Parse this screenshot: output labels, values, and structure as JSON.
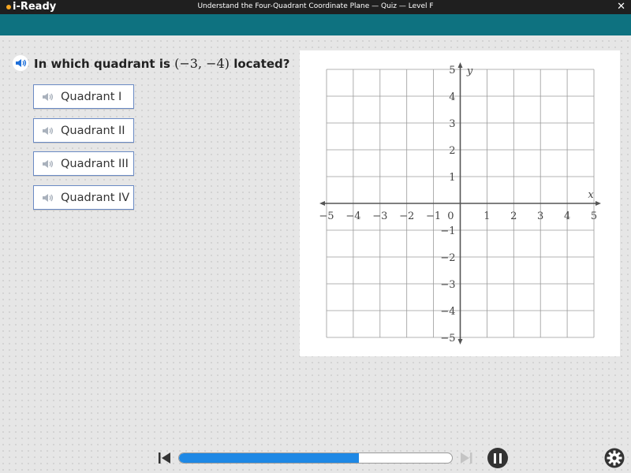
{
  "app": {
    "logo": "i-Ready",
    "title": "Understand the Four-Quadrant Coordinate Plane — Quiz — Level F",
    "close_label": "✕"
  },
  "colors": {
    "teal_bar": "#0e7280",
    "accent_blue": "#1e88e5",
    "answer_border": "#6a8ac4"
  },
  "question": {
    "prefix": "In which quadrant is",
    "math": "(−3, −4)",
    "suffix": "located?"
  },
  "answers": [
    {
      "label": "Quadrant I"
    },
    {
      "label": "Quadrant II"
    },
    {
      "label": "Quadrant III"
    },
    {
      "label": "Quadrant IV"
    }
  ],
  "graph": {
    "x_label": "x",
    "y_label": "y",
    "x_ticks": [
      "−5",
      "−4",
      "−3",
      "−2",
      "−1",
      "1",
      "2",
      "3",
      "4",
      "5"
    ],
    "y_ticks": [
      "5",
      "4",
      "3",
      "2",
      "1",
      "−1",
      "−2",
      "−3",
      "−4",
      "−5"
    ],
    "origin_label": "0",
    "x_range": [
      -5,
      5
    ],
    "y_range": [
      -5,
      5
    ],
    "grid": true
  },
  "progress": {
    "fraction": 0.66
  },
  "icons": {
    "speaker": "speaker-icon",
    "skip_back": "skip-back-icon",
    "skip_forward": "skip-forward-icon",
    "pause": "pause-icon",
    "settings": "gear-icon"
  }
}
